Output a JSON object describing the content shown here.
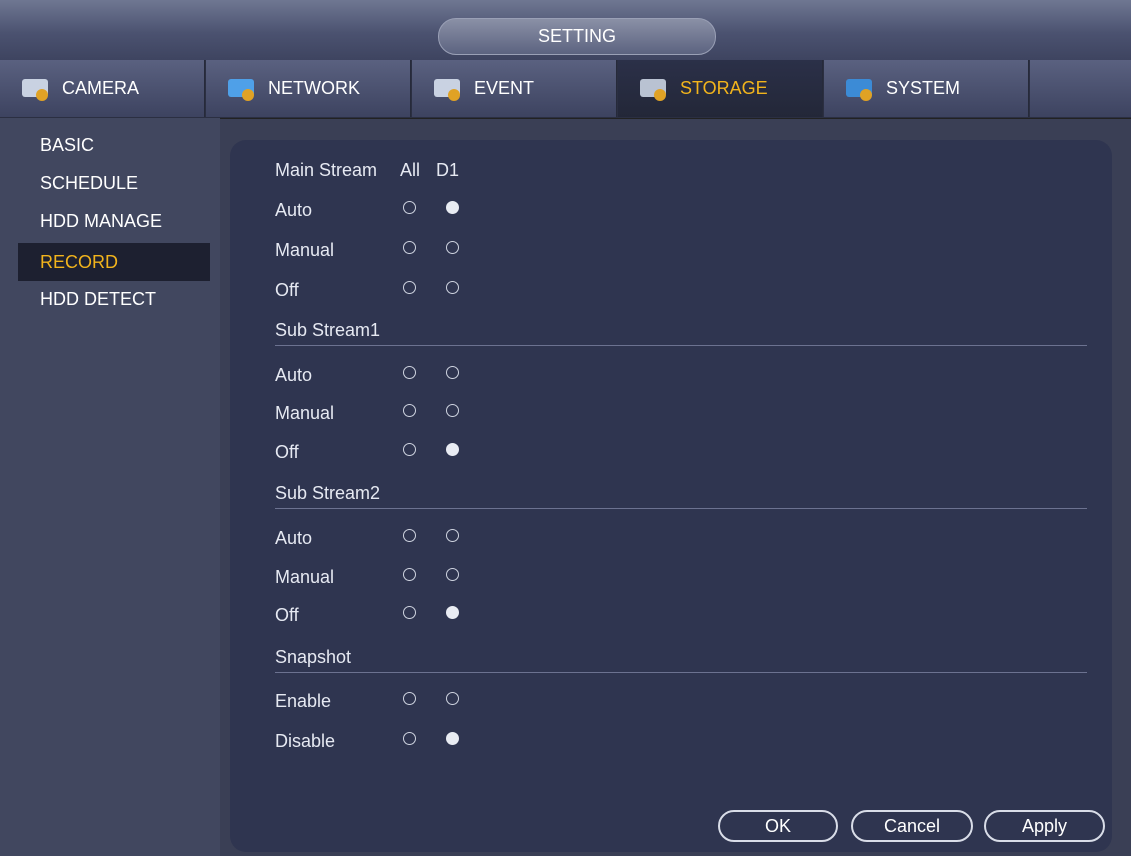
{
  "window": {
    "title": "SETTING"
  },
  "tabs": [
    {
      "label": "CAMERA",
      "icon": "camera-icon"
    },
    {
      "label": "NETWORK",
      "icon": "network-icon"
    },
    {
      "label": "EVENT",
      "icon": "event-icon"
    },
    {
      "label": "STORAGE",
      "icon": "storage-icon",
      "active": true
    },
    {
      "label": "SYSTEM",
      "icon": "system-icon"
    }
  ],
  "sidebar": {
    "items": [
      {
        "label": "BASIC"
      },
      {
        "label": "SCHEDULE"
      },
      {
        "label": "HDD MANAGE"
      },
      {
        "label": "RECORD",
        "active": true
      },
      {
        "label": "HDD DETECT"
      }
    ]
  },
  "record": {
    "main_stream_label": "Main Stream",
    "column_all": "All",
    "column_d1": "D1",
    "main": {
      "auto": "Auto",
      "manual": "Manual",
      "off": "Off",
      "selected_d1": "Auto"
    },
    "sub_stream1": {
      "title": "Sub Stream1",
      "auto": "Auto",
      "manual": "Manual",
      "off": "Off",
      "selected_d1": "Off"
    },
    "sub_stream2": {
      "title": "Sub Stream2",
      "auto": "Auto",
      "manual": "Manual",
      "off": "Off",
      "selected_d1": "Off"
    },
    "snapshot": {
      "title": "Snapshot",
      "enable": "Enable",
      "disable": "Disable",
      "selected_d1": "Disable"
    }
  },
  "buttons": {
    "ok": "OK",
    "cancel": "Cancel",
    "apply": "Apply"
  },
  "colors": {
    "accent": "#f2b41c",
    "panel": "#2f3550"
  }
}
